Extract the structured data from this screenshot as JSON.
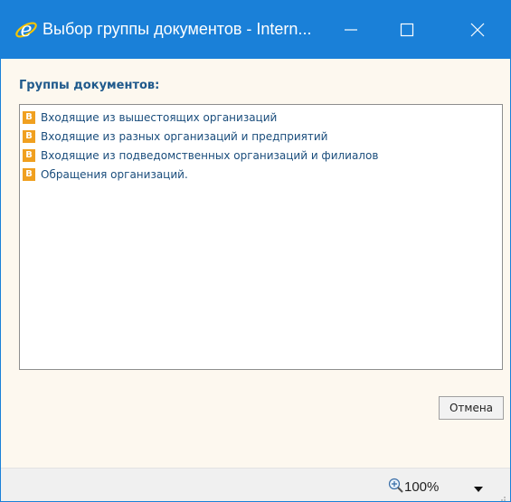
{
  "window": {
    "title": "Выбор группы документов - Intern...",
    "icon": "ie-icon",
    "controls": [
      "minimize-icon",
      "maximize-icon",
      "close-icon"
    ],
    "title_color": "#1a80d8"
  },
  "main": {
    "groups_label": "Группы документов:",
    "items": [
      {
        "badge": "B",
        "label": "Входящие из вышестоящих организаций"
      },
      {
        "badge": "B",
        "label": "Входящие из разных организаций и предприятий"
      },
      {
        "badge": "B",
        "label": "Входящие из подведомственных организаций и филиалов"
      },
      {
        "badge": "B",
        "label": "Обращения организаций."
      }
    ],
    "cancel_label": "Отмена",
    "badge_color": "#f0a020"
  },
  "statusbar": {
    "zoom": "100%",
    "zoom_icon": "zoom-in-icon",
    "dropdown_icon": "chevron-down-icon"
  }
}
